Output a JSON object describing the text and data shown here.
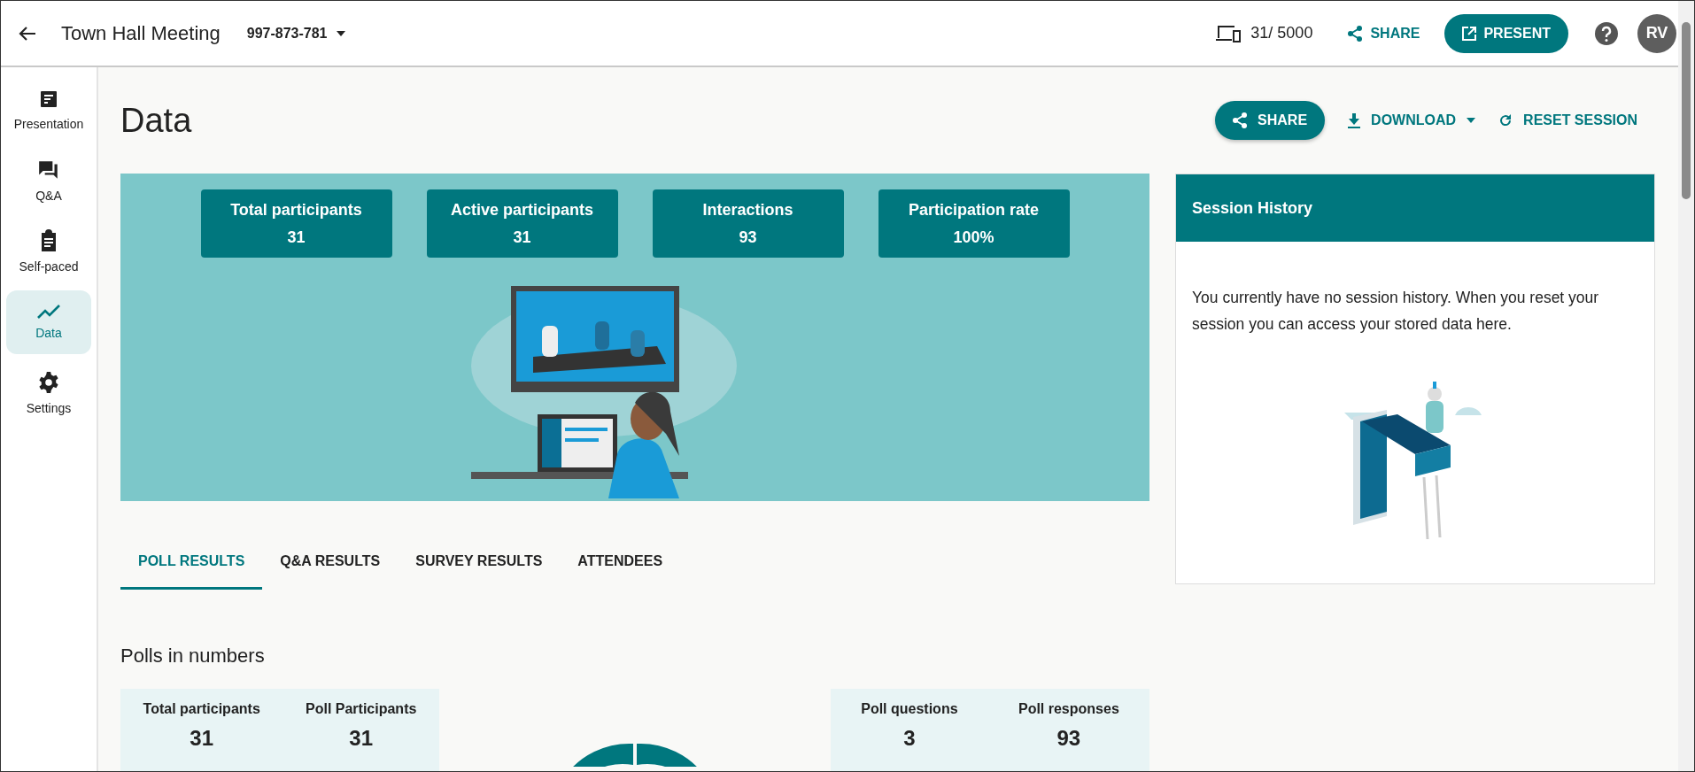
{
  "header": {
    "title": "Town Hall Meeting",
    "meeting_id": "997-873-781",
    "participants": "31/ 5000",
    "share": "SHARE",
    "present": "PRESENT",
    "avatar": "RV"
  },
  "sidebar": {
    "items": [
      {
        "label": "Presentation",
        "kind": "presentation",
        "selected": false
      },
      {
        "label": "Q&A",
        "kind": "qa",
        "selected": false
      },
      {
        "label": "Self-paced",
        "kind": "clipboard",
        "selected": false
      },
      {
        "label": "Data",
        "kind": "chart",
        "selected": true
      },
      {
        "label": "Settings",
        "kind": "gear",
        "selected": false
      }
    ]
  },
  "page_title": "Data",
  "actions": [
    {
      "kind": "share",
      "label": "SHARE"
    },
    {
      "kind": "download",
      "label": "DOWNLOAD"
    },
    {
      "kind": "reset",
      "label": "RESET SESSION"
    }
  ],
  "banner": {
    "stats": [
      {
        "label": "Total participants",
        "value": "31"
      },
      {
        "label": "Active participants",
        "value": "31"
      },
      {
        "label": "Interactions",
        "value": "93"
      },
      {
        "label": "Participation rate",
        "value": "100%"
      }
    ]
  },
  "session_history": {
    "title": "Session History",
    "message": "You currently have no session history. When you reset your session you can access your stored data here."
  },
  "tabs": [
    {
      "label": "POLL RESULTS",
      "selected": true
    },
    {
      "label": "Q&A RESULTS",
      "selected": false
    },
    {
      "label": "SURVEY RESULTS",
      "selected": false
    },
    {
      "label": "ATTENDEES",
      "selected": false
    }
  ],
  "polls": {
    "title": "Polls in numbers",
    "left_stats": [
      {
        "label": "Total participants",
        "value": "31"
      },
      {
        "label": "Poll Participants",
        "value": "31"
      }
    ],
    "right_stats": [
      {
        "label": "Poll questions",
        "value": "3"
      },
      {
        "label": "Poll responses",
        "value": "93"
      }
    ]
  }
}
